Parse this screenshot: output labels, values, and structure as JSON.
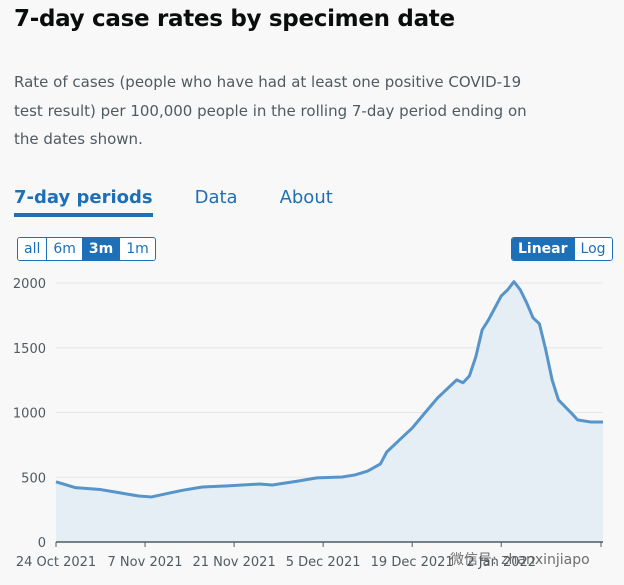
{
  "title": "7-day case rates by specimen date",
  "description": "Rate of cases (people who have had at least one positive COVID-19 test result) per 100,000 people in the rolling 7-day period ending on the dates shown.",
  "tabs": [
    {
      "label": "7-day periods",
      "active": true
    },
    {
      "label": "Data"
    },
    {
      "label": "About"
    }
  ],
  "range_buttons": [
    {
      "label": "all"
    },
    {
      "label": "6m"
    },
    {
      "label": "3m",
      "active": true
    },
    {
      "label": "1m"
    }
  ],
  "scale_buttons": [
    {
      "label": "Linear",
      "active": true
    },
    {
      "label": "Log"
    }
  ],
  "watermark": "微信号: zhanxinjiapo",
  "colors": {
    "accent": "#1d70b8",
    "line": "#5694ca",
    "fill": "#e5edf5"
  },
  "chart_data": {
    "type": "area",
    "ylim": [
      0,
      2000
    ],
    "yticks": [
      "0",
      "500",
      "1000",
      "1500",
      "2000"
    ],
    "xticks": [
      "24 Oct 2021",
      "7 Nov 2021",
      "21 Nov 2021",
      "5 Dec 2021",
      "19 Dec 2021",
      "2 Jan 2022"
    ],
    "xlim": [
      "2021-10-24",
      "2022-01-18"
    ],
    "grid": true,
    "x": [
      "2021-10-24",
      "2021-10-27",
      "2021-10-31",
      "2021-11-03",
      "2021-11-06",
      "2021-11-08",
      "2021-11-11",
      "2021-11-13",
      "2021-11-16",
      "2021-11-20",
      "2021-11-25",
      "2021-11-27",
      "2021-12-01",
      "2021-12-04",
      "2021-12-08",
      "2021-12-10",
      "2021-12-12",
      "2021-12-14",
      "2021-12-15",
      "2021-12-17",
      "2021-12-19",
      "2021-12-21",
      "2021-12-23",
      "2021-12-26",
      "2021-12-27",
      "2021-12-28",
      "2021-12-29",
      "2021-12-30",
      "2021-12-31",
      "2022-01-01",
      "2022-01-02",
      "2022-01-03",
      "2022-01-04",
      "2022-01-05",
      "2022-01-06",
      "2022-01-07",
      "2022-01-08",
      "2022-01-09",
      "2022-01-10",
      "2022-01-11",
      "2022-01-13",
      "2022-01-14",
      "2022-01-16",
      "2022-01-18"
    ],
    "values": [
      465,
      420,
      405,
      380,
      355,
      348,
      380,
      400,
      425,
      433,
      448,
      440,
      470,
      495,
      502,
      518,
      548,
      603,
      695,
      788,
      880,
      997,
      1113,
      1252,
      1230,
      1283,
      1430,
      1638,
      1716,
      1808,
      1900,
      1947,
      2010,
      1947,
      1847,
      1731,
      1685,
      1484,
      1252,
      1097,
      997,
      943,
      927,
      927
    ]
  }
}
